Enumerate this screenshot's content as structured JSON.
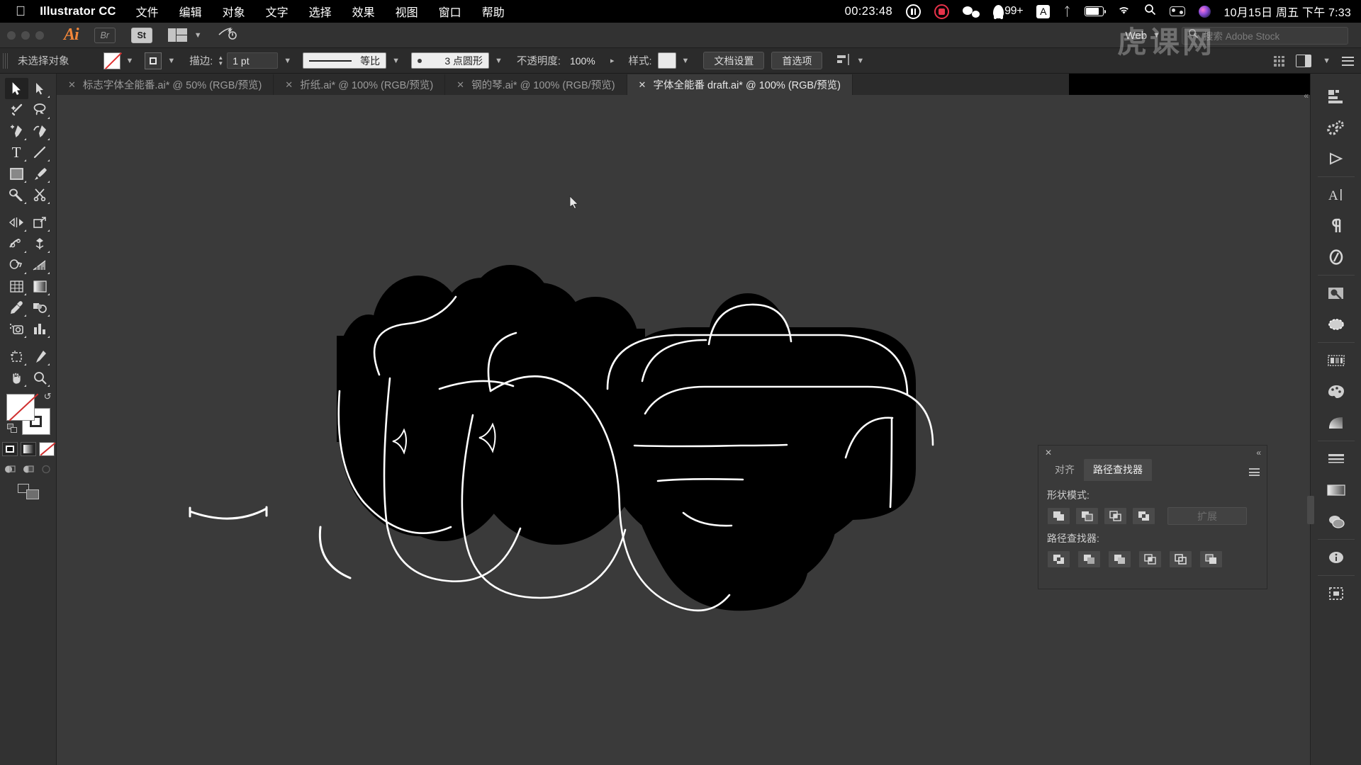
{
  "menubar": {
    "apple_icon": "apple-icon",
    "app_name": "Illustrator CC",
    "items": [
      "文件",
      "编辑",
      "对象",
      "文字",
      "选择",
      "效果",
      "视图",
      "窗口",
      "帮助"
    ],
    "recording_time": "00:23:48",
    "pause_icon": "pause-icon",
    "record_icon": "record-icon",
    "wechat_icon": "wechat-icon",
    "qq_icon": "qq-icon",
    "qq_badge": "99+",
    "input_source": "A",
    "bluetooth_icon": "bluetooth-icon",
    "battery_icon": "battery-icon",
    "wifi_icon": "wifi-icon",
    "search_icon": "spotlight-search-icon",
    "controlcenter_icon": "control-center-icon",
    "siri_icon": "siri-icon",
    "datetime": "10月15日 周五 下午 7:33"
  },
  "appbar": {
    "logo": "Ai",
    "bridge_label": "Br",
    "stock_label": "St",
    "arrange_icon": "arrange-documents-icon",
    "chevron_icon": "chevron-down-icon",
    "sync_icon": "sync-settings-icon",
    "workspace": "Web",
    "search_placeholder": "搜索 Adobe Stock",
    "search_icon": "search-icon"
  },
  "controlbar": {
    "selection_status": "未选择对象",
    "fill_swatch": "none-fill-swatch",
    "stroke_swatch": "stroke-swatch",
    "stroke_label": "描边:",
    "stroke_weight": "1 pt",
    "stroke_profile": "等比",
    "brush_def": "3 点圆形",
    "opacity_label": "不透明度:",
    "opacity_value": "100%",
    "style_label": "样式:",
    "doc_setup": "文档设置",
    "preferences": "首选项",
    "align_icon": "align-icon",
    "grid_icon": "grid-view-icon",
    "dock_icon": "dock-panels-icon",
    "menu_icon": "panel-menu-icon"
  },
  "tabs": [
    {
      "title": "标志字体全能番.ai* @ 50% (RGB/预览)",
      "active": false
    },
    {
      "title": "折纸.ai* @ 100% (RGB/预览)",
      "active": false
    },
    {
      "title": "钢的琴.ai* @ 100% (RGB/预览)",
      "active": false
    },
    {
      "title": "字体全能番 draft.ai* @ 100% (RGB/预览)",
      "active": true
    }
  ],
  "toolbar": {
    "tools": [
      {
        "name": "selection-tool",
        "selected": true
      },
      {
        "name": "direct-selection-tool",
        "selected": false
      },
      {
        "name": "magic-wand-tool",
        "selected": false
      },
      {
        "name": "lasso-tool",
        "selected": false
      },
      {
        "name": "pen-tool",
        "selected": false
      },
      {
        "name": "curvature-tool",
        "selected": false
      },
      {
        "name": "type-tool",
        "selected": false
      },
      {
        "name": "line-segment-tool",
        "selected": false
      },
      {
        "name": "rectangle-tool",
        "selected": false
      },
      {
        "name": "paintbrush-tool",
        "selected": false
      },
      {
        "name": "shaper-tool",
        "selected": false
      },
      {
        "name": "scissors-tool",
        "selected": false
      },
      {
        "name": "rotate-tool",
        "selected": false
      },
      {
        "name": "scale-tool",
        "selected": false
      },
      {
        "name": "width-tool",
        "selected": false
      },
      {
        "name": "free-transform-tool",
        "selected": false
      },
      {
        "name": "shape-builder-tool",
        "selected": false
      },
      {
        "name": "perspective-grid-tool",
        "selected": false
      },
      {
        "name": "mesh-tool",
        "selected": false
      },
      {
        "name": "gradient-tool",
        "selected": false
      },
      {
        "name": "eyedropper-tool",
        "selected": false
      },
      {
        "name": "blend-tool",
        "selected": false
      },
      {
        "name": "symbol-sprayer-tool",
        "selected": false
      },
      {
        "name": "column-graph-tool",
        "selected": false
      },
      {
        "name": "artboard-tool",
        "selected": false
      },
      {
        "name": "slice-tool",
        "selected": false
      },
      {
        "name": "hand-tool",
        "selected": false
      },
      {
        "name": "zoom-tool",
        "selected": false
      }
    ],
    "fill_swatch": "fill-none-swatch",
    "stroke_swatch": "stroke-black-swatch",
    "swap_icon": "swap-fill-stroke-icon",
    "default_icon": "default-fill-stroke-icon",
    "color_mode": "color-mode-button",
    "gradient_mode": "gradient-mode-button",
    "none_mode": "none-mode-button",
    "draw_normal": "draw-normal-icon",
    "draw_behind": "draw-behind-icon",
    "draw_inside": "draw-inside-icon",
    "screen_mode": "screen-mode-icon"
  },
  "rightdock": {
    "icons": [
      "layers-icon",
      "actions-icon",
      "play-icon",
      "character-icon",
      "paragraph-icon",
      "glyphs-icon",
      "image-trace-icon",
      "transparency-icon",
      "swatches-icon",
      "color-icon",
      "gradient-icon",
      "stroke-panel-icon",
      "gradient-panel-icon",
      "appearance-icon",
      "info-icon",
      "artboards-icon"
    ]
  },
  "pathfinder": {
    "close_icon": "close-icon",
    "collapse_icon": "collapse-panel-icon",
    "tabs": [
      {
        "label": "对齐",
        "active": false
      },
      {
        "label": "路径查找器",
        "active": true
      }
    ],
    "menu_icon": "panel-menu-icon",
    "shape_modes_label": "形状模式:",
    "shape_modes": [
      "unite-icon",
      "minus-front-icon",
      "intersect-icon",
      "exclude-icon"
    ],
    "expand_button": "扩展",
    "pathfinders_label": "路径查找器:",
    "pathfinders": [
      "divide-icon",
      "trim-icon",
      "merge-icon",
      "crop-icon",
      "outline-icon",
      "minus-back-icon"
    ]
  },
  "canvas": {
    "artwork_name": "blob-lettering-artwork",
    "background_color": "#3a3a3a",
    "shape_fill": "#000000",
    "outline_color": "#ffffff",
    "cursor": "arrow-cursor"
  },
  "watermark": {
    "text": "虎课网"
  }
}
